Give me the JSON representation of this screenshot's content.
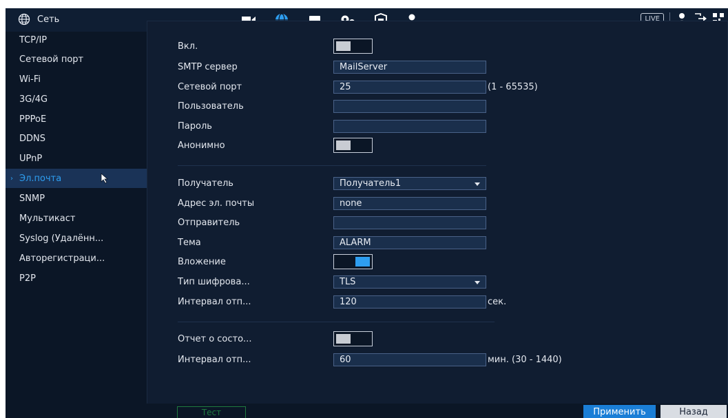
{
  "header": {
    "title": "Сеть",
    "live_label": "LIVE"
  },
  "sidebar": {
    "items": [
      {
        "label": "TCP/IP"
      },
      {
        "label": "Сетевой порт"
      },
      {
        "label": "Wi-Fi"
      },
      {
        "label": "3G/4G"
      },
      {
        "label": "PPPoE"
      },
      {
        "label": "DDNS"
      },
      {
        "label": "UPnP"
      },
      {
        "label": "Эл.почта",
        "active": true
      },
      {
        "label": "SNMP"
      },
      {
        "label": "Мультикаст"
      },
      {
        "label": "Syslog (Удалённ..."
      },
      {
        "label": "Авторегистраци..."
      },
      {
        "label": "P2P"
      }
    ]
  },
  "form": {
    "enable_label": "Вкл.",
    "smtp_label": "SMTP сервер",
    "smtp_value": "MailServer",
    "port_label": "Сетевой порт",
    "port_value": "25",
    "port_range": "(1 - 65535)",
    "user_label": "Пользователь",
    "user_value": "",
    "password_label": "Пароль",
    "password_value": "",
    "anon_label": "Анонимно",
    "recipient_label": "Получатель",
    "recipient_value": "Получатель1",
    "email_label": "Адрес эл. почты",
    "email_value": "none",
    "sender_label": "Отправитель",
    "sender_value": "",
    "subject_label": "Тема",
    "subject_value": "ALARM",
    "attach_label": "Вложение",
    "encrypt_label": "Тип шифрова...",
    "encrypt_value": "TLS",
    "interval_label": "Интервал отп...",
    "interval_value": "120",
    "interval_unit": "сек.",
    "report_label": "Отчет о состо...",
    "report_interval_label": "Интервал отп...",
    "report_interval_value": "60",
    "report_interval_unit": "мин. (30 - 1440)"
  },
  "toggles": {
    "enable": false,
    "anonymous": false,
    "attachment": true,
    "report": false
  },
  "buttons": {
    "test": "Тест",
    "apply": "Применить",
    "back": "Назад"
  },
  "colors": {
    "accent": "#2e9ef0",
    "background": "#0b1626",
    "panel": "#101d31",
    "apply": "#1a7ed6"
  }
}
